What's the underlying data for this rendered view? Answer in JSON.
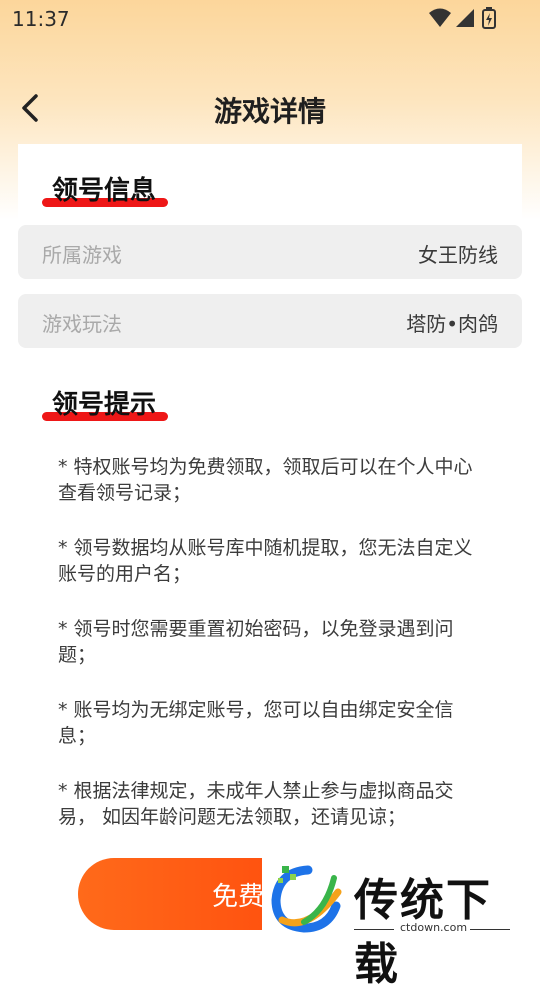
{
  "status_bar": {
    "time": "11:37"
  },
  "header": {
    "title": "游戏详情"
  },
  "account_info": {
    "title": "领号信息",
    "rows": [
      {
        "label": "所属游戏",
        "value": "女王防线"
      },
      {
        "label": "游戏玩法",
        "value": "塔防•肉鸽"
      }
    ]
  },
  "tips": {
    "title": "领号提示",
    "items": [
      "* 特权账号均为免费领取，领取后可以在个人中心 查看领号记录；",
      "*  领号数据均从账号库中随机提取，您无法自定义 账号的用户名；",
      "*  领号时您需要重置初始密码，以免登录遇到问题；",
      "*  账号均为无绑定账号，您可以自由绑定安全信息；",
      "*  根据法律规定，未成年人禁止参与虚拟商品交易， 如因年龄问题无法领取，还请见谅；"
    ]
  },
  "claim_button": {
    "label": "免费"
  },
  "watermark": {
    "name": "传统下载",
    "url": "ctdown.com"
  },
  "colors": {
    "accent": "#ee1717",
    "button": "#ff4a0a",
    "header_bg": "#fcd69b"
  }
}
